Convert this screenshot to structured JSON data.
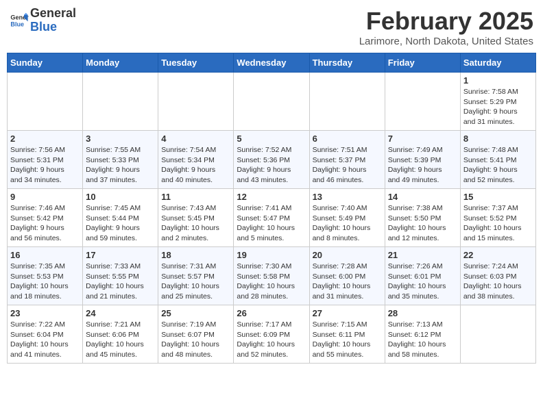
{
  "header": {
    "logo": {
      "general": "General",
      "blue": "Blue"
    },
    "title": "February 2025",
    "location": "Larimore, North Dakota, United States"
  },
  "weekdays": [
    "Sunday",
    "Monday",
    "Tuesday",
    "Wednesday",
    "Thursday",
    "Friday",
    "Saturday"
  ],
  "weeks": [
    [
      {
        "day": "",
        "info": ""
      },
      {
        "day": "",
        "info": ""
      },
      {
        "day": "",
        "info": ""
      },
      {
        "day": "",
        "info": ""
      },
      {
        "day": "",
        "info": ""
      },
      {
        "day": "",
        "info": ""
      },
      {
        "day": "1",
        "info": "Sunrise: 7:58 AM\nSunset: 5:29 PM\nDaylight: 9 hours\nand 31 minutes."
      }
    ],
    [
      {
        "day": "2",
        "info": "Sunrise: 7:56 AM\nSunset: 5:31 PM\nDaylight: 9 hours\nand 34 minutes."
      },
      {
        "day": "3",
        "info": "Sunrise: 7:55 AM\nSunset: 5:33 PM\nDaylight: 9 hours\nand 37 minutes."
      },
      {
        "day": "4",
        "info": "Sunrise: 7:54 AM\nSunset: 5:34 PM\nDaylight: 9 hours\nand 40 minutes."
      },
      {
        "day": "5",
        "info": "Sunrise: 7:52 AM\nSunset: 5:36 PM\nDaylight: 9 hours\nand 43 minutes."
      },
      {
        "day": "6",
        "info": "Sunrise: 7:51 AM\nSunset: 5:37 PM\nDaylight: 9 hours\nand 46 minutes."
      },
      {
        "day": "7",
        "info": "Sunrise: 7:49 AM\nSunset: 5:39 PM\nDaylight: 9 hours\nand 49 minutes."
      },
      {
        "day": "8",
        "info": "Sunrise: 7:48 AM\nSunset: 5:41 PM\nDaylight: 9 hours\nand 52 minutes."
      }
    ],
    [
      {
        "day": "9",
        "info": "Sunrise: 7:46 AM\nSunset: 5:42 PM\nDaylight: 9 hours\nand 56 minutes."
      },
      {
        "day": "10",
        "info": "Sunrise: 7:45 AM\nSunset: 5:44 PM\nDaylight: 9 hours\nand 59 minutes."
      },
      {
        "day": "11",
        "info": "Sunrise: 7:43 AM\nSunset: 5:45 PM\nDaylight: 10 hours\nand 2 minutes."
      },
      {
        "day": "12",
        "info": "Sunrise: 7:41 AM\nSunset: 5:47 PM\nDaylight: 10 hours\nand 5 minutes."
      },
      {
        "day": "13",
        "info": "Sunrise: 7:40 AM\nSunset: 5:49 PM\nDaylight: 10 hours\nand 8 minutes."
      },
      {
        "day": "14",
        "info": "Sunrise: 7:38 AM\nSunset: 5:50 PM\nDaylight: 10 hours\nand 12 minutes."
      },
      {
        "day": "15",
        "info": "Sunrise: 7:37 AM\nSunset: 5:52 PM\nDaylight: 10 hours\nand 15 minutes."
      }
    ],
    [
      {
        "day": "16",
        "info": "Sunrise: 7:35 AM\nSunset: 5:53 PM\nDaylight: 10 hours\nand 18 minutes."
      },
      {
        "day": "17",
        "info": "Sunrise: 7:33 AM\nSunset: 5:55 PM\nDaylight: 10 hours\nand 21 minutes."
      },
      {
        "day": "18",
        "info": "Sunrise: 7:31 AM\nSunset: 5:57 PM\nDaylight: 10 hours\nand 25 minutes."
      },
      {
        "day": "19",
        "info": "Sunrise: 7:30 AM\nSunset: 5:58 PM\nDaylight: 10 hours\nand 28 minutes."
      },
      {
        "day": "20",
        "info": "Sunrise: 7:28 AM\nSunset: 6:00 PM\nDaylight: 10 hours\nand 31 minutes."
      },
      {
        "day": "21",
        "info": "Sunrise: 7:26 AM\nSunset: 6:01 PM\nDaylight: 10 hours\nand 35 minutes."
      },
      {
        "day": "22",
        "info": "Sunrise: 7:24 AM\nSunset: 6:03 PM\nDaylight: 10 hours\nand 38 minutes."
      }
    ],
    [
      {
        "day": "23",
        "info": "Sunrise: 7:22 AM\nSunset: 6:04 PM\nDaylight: 10 hours\nand 41 minutes."
      },
      {
        "day": "24",
        "info": "Sunrise: 7:21 AM\nSunset: 6:06 PM\nDaylight: 10 hours\nand 45 minutes."
      },
      {
        "day": "25",
        "info": "Sunrise: 7:19 AM\nSunset: 6:07 PM\nDaylight: 10 hours\nand 48 minutes."
      },
      {
        "day": "26",
        "info": "Sunrise: 7:17 AM\nSunset: 6:09 PM\nDaylight: 10 hours\nand 52 minutes."
      },
      {
        "day": "27",
        "info": "Sunrise: 7:15 AM\nSunset: 6:11 PM\nDaylight: 10 hours\nand 55 minutes."
      },
      {
        "day": "28",
        "info": "Sunrise: 7:13 AM\nSunset: 6:12 PM\nDaylight: 10 hours\nand 58 minutes."
      },
      {
        "day": "",
        "info": ""
      }
    ]
  ]
}
